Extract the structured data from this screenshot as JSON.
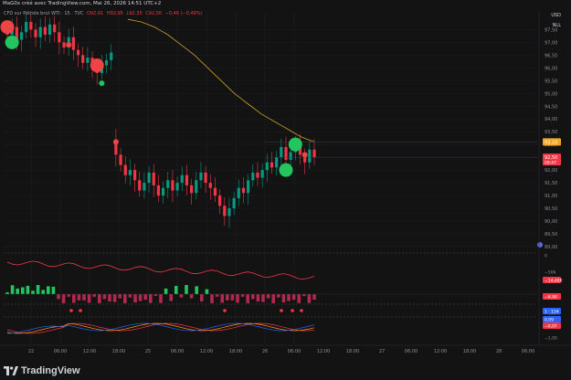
{
  "topbar": {
    "text": "MaG0x créé avec TradingView.com, Mai 26, 2026 14:51 UTC+2"
  },
  "legend": {
    "title": "CFD sur Pétrole brut WTI · 15 · TVC",
    "values": [
      "O92,91",
      "H92,95",
      "L92,35",
      "C92,50",
      "−0,46 (−0,49%)"
    ]
  },
  "axis_unit": {
    "currency": "USD",
    "badge": "NLL"
  },
  "price_axis": {
    "ticks": [
      "97,50",
      "97,00",
      "96,50",
      "96,00",
      "95,50",
      "95,00",
      "94,50",
      "94,00",
      "93,50",
      "93,00",
      "92,50",
      "92,00",
      "91,50",
      "91,00",
      "90,50",
      "90,00",
      "89,50",
      "89,00"
    ],
    "tags": [
      {
        "label": "93,10",
        "color": "#f5a623"
      },
      {
        "label": "92,50",
        "sub": "08:47",
        "color": "#f23645"
      }
    ]
  },
  "indicator_axis": {
    "labels": [
      "0",
      "−50K",
      "−14,48K",
      "−6,90",
      "−10,00",
      "1 · 154",
      "0,09",
      "−0,07",
      "−1,00"
    ]
  },
  "time_axis": {
    "ticks": [
      "22",
      "06:00",
      "12:00",
      "18:00",
      "25",
      "06:00",
      "12:00",
      "18:00",
      "26",
      "06:00",
      "12:00",
      "18:00",
      "27",
      "06:00",
      "12:00",
      "18:00",
      "28",
      "06:00",
      "12:00"
    ]
  },
  "colors": {
    "up": "#089981",
    "down": "#f23645",
    "ma": "#c9a227",
    "signal_up": "#22c55e",
    "signal_down": "#ef4444",
    "bg": "#131313"
  },
  "footer": {
    "brand": "TradingView"
  },
  "chart_data": {
    "type": "candlestick",
    "title": "CFD sur Pétrole brut WTI · 15 · TVC",
    "yrange": [
      89.0,
      97.8
    ],
    "close_path": [
      97.3,
      97.6,
      97.1,
      97.4,
      97.8,
      97.5,
      97.2,
      97.6,
      97.3,
      97.7,
      97.4,
      97.0,
      96.8,
      97.2,
      96.7,
      96.5,
      96.2,
      96.4,
      96.0,
      95.8,
      96.1,
      96.3,
      96.6,
      92.6,
      92.2,
      91.8,
      92.0,
      91.6,
      91.2,
      91.5,
      91.9,
      91.4,
      91.0,
      91.3,
      91.6,
      91.2,
      91.5,
      91.8,
      91.4,
      91.1,
      91.6,
      91.9,
      91.5,
      91.3,
      91.0,
      90.6,
      90.2,
      90.5,
      90.9,
      91.3,
      91.1,
      91.6,
      91.9,
      91.7,
      92.0,
      92.3,
      92.1,
      92.5,
      92.9,
      92.4,
      92.7,
      93.0,
      92.6,
      92.3,
      92.8,
      92.5
    ],
    "ma_path": [
      97.9,
      97.85,
      97.8,
      97.7,
      97.6,
      97.45,
      97.3,
      97.1,
      96.9,
      96.7,
      96.5,
      96.25,
      96.0,
      95.75,
      95.5,
      95.25,
      95.0,
      94.8,
      94.6,
      94.4,
      94.2,
      94.05,
      93.9,
      93.75,
      93.6,
      93.45,
      93.3,
      93.2,
      93.1
    ],
    "signals": [
      {
        "i": 1,
        "price": 97.0,
        "dir": "up",
        "big": true
      },
      {
        "i": 0,
        "price": 97.6,
        "dir": "down",
        "big": true
      },
      {
        "i": 13,
        "price": 96.9,
        "dir": "down",
        "big": false
      },
      {
        "i": 19,
        "price": 96.1,
        "dir": "down",
        "big": true
      },
      {
        "i": 20,
        "price": 95.4,
        "dir": "up",
        "big": false
      },
      {
        "i": 23,
        "price": 93.1,
        "dir": "down",
        "big": false
      },
      {
        "i": 59,
        "price": 92.0,
        "dir": "up",
        "big": true
      },
      {
        "i": 61,
        "price": 93.0,
        "dir": "up",
        "big": true
      },
      {
        "i": 63,
        "price": 92.6,
        "dir": "down",
        "big": false
      }
    ]
  }
}
